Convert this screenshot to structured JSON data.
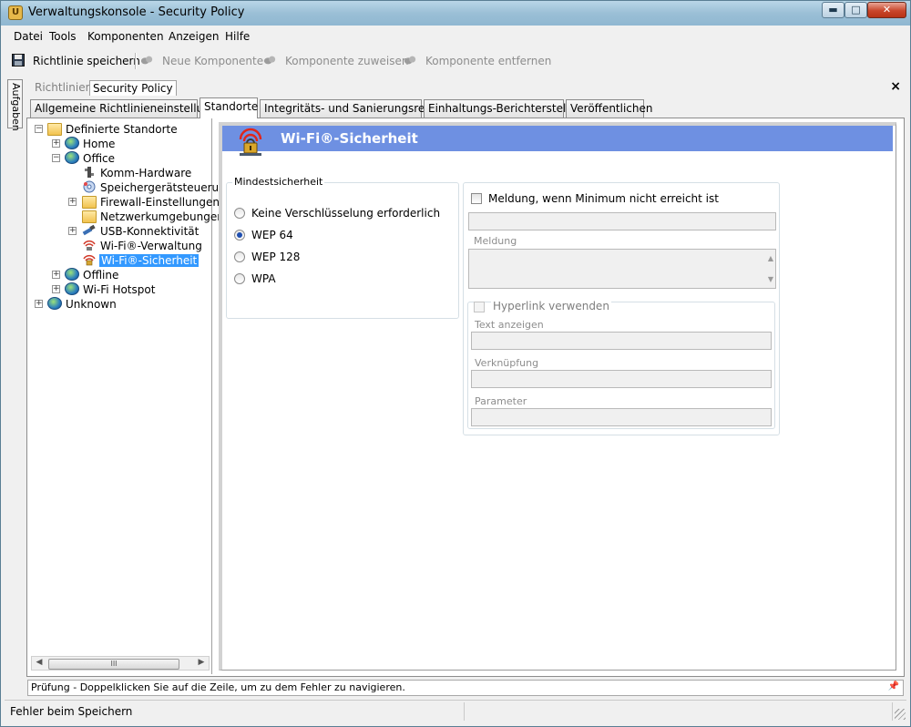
{
  "window": {
    "title": "Verwaltungskonsole - Security Policy",
    "app_icon_glyph": "U",
    "min_icon": "▬",
    "max_icon": "□",
    "close_icon": "✕"
  },
  "menu": [
    "Datei",
    "Tools",
    "Komponenten",
    "Anzeigen",
    "Hilfe"
  ],
  "toolbar": {
    "save": "Richtlinie speichern",
    "new": "Neue Komponente",
    "assign": "Komponente zuweisen",
    "remove": "Komponente entfernen"
  },
  "sidetab": "Aufgaben",
  "doc_tabs": {
    "policies": "Richtlinien",
    "security_policy": "Security Policy",
    "close": "×"
  },
  "tabs": [
    "Allgemeine Richtlinieneinstellungen",
    "Standorte",
    "Integritäts- und Sanierungsregeln",
    "Einhaltungs-Berichterstellung",
    "Veröffentlichen"
  ],
  "tree": {
    "root": "Definierte Standorte",
    "home": "Home",
    "office": "Office",
    "office_children": [
      "Komm-Hardware",
      "Speichergerätsteuerun",
      "Firewall-Einstellungen",
      "Netzwerkumgebungen",
      "USB-Konnektivität",
      "Wi-Fi®-Verwaltung",
      "Wi-Fi®-Sicherheit"
    ],
    "offline": "Offline",
    "hotspot": "Wi-Fi Hotspot",
    "unknown": "Unknown",
    "expanded_symbol": "−",
    "collapsed_symbol": "+",
    "scroll_left": "◀",
    "scroll_right": "▶",
    "scroll_thumb": "III"
  },
  "detail": {
    "title": "Wi-Fi®-Sicherheit",
    "min_security": {
      "title": "Mindestsicherheit",
      "options": [
        "Keine Verschlüsselung erforderlich",
        "WEP 64",
        "WEP 128",
        "WPA"
      ],
      "selected": "WEP 64"
    },
    "notify": {
      "checkbox_label": "Meldung, wenn Minimum nicht erreicht ist",
      "message_label": "Meldung",
      "hyperlink_label": "Hyperlink verwenden",
      "text_label": "Text anzeigen",
      "link_label": "Verknüpfung",
      "param_label": "Parameter",
      "scroll_up": "▲",
      "scroll_down": "▼"
    }
  },
  "error_bar": {
    "text": "Prüfung - Doppelklicken Sie auf die Zeile, um zu dem Fehler zu navigieren.",
    "pin": "📌"
  },
  "status": "Fehler beim Speichern",
  "colors": {
    "header_blue": "#6e90e2",
    "selection": "#3399ff"
  }
}
